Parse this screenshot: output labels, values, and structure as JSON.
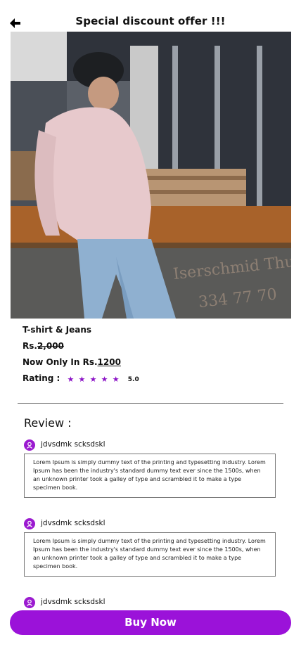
{
  "header": {
    "title": "Special discount offer !!!",
    "back_icon": "arrow-left-icon"
  },
  "product": {
    "name": "T-shirt & Jeans",
    "old_price_prefix": "Rs.",
    "old_price": "2,000",
    "offer_prefix": "Now Only In Rs.",
    "offer_price": "1200",
    "rating_label": "Rating :",
    "rating_value": "5.0",
    "stars": 5
  },
  "reviews_section": {
    "title": "Review :",
    "items": [
      {
        "name": "jdvsdmk scksdskl",
        "text": "Lorem Ipsum is simply dummy text of the printing and typesetting industry. Lorem Ipsum has been the industry's standard dummy text ever since the 1500s, when an unknown printer took a galley of type and scrambled it to make a type specimen book."
      },
      {
        "name": "jdvsdmk scksdskl",
        "text": "Lorem Ipsum is simply dummy text of the printing and typesetting industry. Lorem Ipsum has been the industry's standard dummy text ever since the 1500s, when an unknown printer took a galley of type and scrambled it to make a type specimen book."
      },
      {
        "name": "jdvsdmk scksdskl",
        "text": ""
      }
    ]
  },
  "cta": {
    "buy_label": "Buy Now"
  },
  "colors": {
    "accent": "#9b12d9",
    "star": "#8b12c6"
  }
}
